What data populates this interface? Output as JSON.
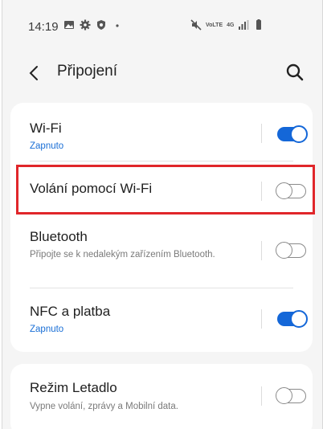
{
  "status_bar": {
    "time": "14:19",
    "left_icons": [
      "gallery-icon",
      "gear-icon",
      "shield-icon",
      "dot-icon"
    ],
    "right_icons": [
      "mute-icon",
      "volte-icon",
      "4g-icon",
      "signal-icon",
      "battery-icon"
    ],
    "volte_text": "VoLTE",
    "network_text": "4G"
  },
  "header": {
    "title": "Připojení"
  },
  "settings": [
    {
      "title": "Wi-Fi",
      "subtitle": "Zapnuto",
      "enabled": true
    },
    {
      "title": "Volání pomocí Wi-Fi",
      "subtitle": "",
      "enabled": false
    },
    {
      "title": "Bluetooth",
      "subtitle": "Připojte se k nedalekým zařízením Bluetooth.",
      "enabled": false
    },
    {
      "title": "NFC a platba",
      "subtitle": "Zapnuto",
      "enabled": true
    }
  ],
  "settings2": [
    {
      "title": "Režim Letadlo",
      "subtitle": "Vypne volání, zprávy a Mobilní data.",
      "enabled": false
    }
  ],
  "colors": {
    "accent": "#1467d8",
    "highlight": "#e0262a",
    "background": "#f5f5f5"
  }
}
